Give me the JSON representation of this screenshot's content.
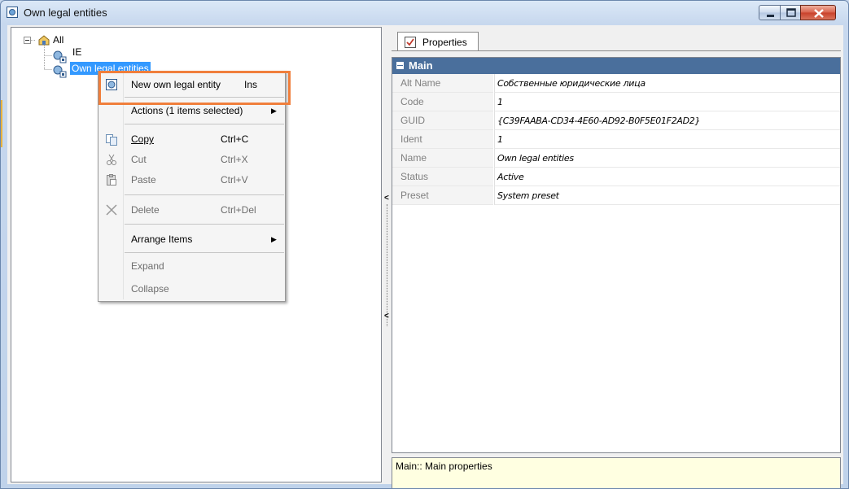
{
  "window": {
    "title": "Own legal entities",
    "controls": {
      "minimize": "minimize",
      "maximize": "maximize",
      "close": "close"
    }
  },
  "tree": {
    "root": {
      "label": "All",
      "icon": "folder-home-icon"
    },
    "children": [
      {
        "label": "IE",
        "icon": "legal-entity-icon"
      },
      {
        "label": "Own legal entities",
        "icon": "legal-entity-icon",
        "selected": true
      }
    ]
  },
  "context_menu": {
    "items": [
      {
        "label": "New own legal entity",
        "shortcut": "Ins",
        "icon": "new-entity-icon",
        "enabled": true
      },
      {
        "label": "Actions (1 items selected)",
        "submenu": true,
        "enabled": true
      },
      {
        "label": "Copy",
        "shortcut": "Ctrl+C",
        "icon": "copy-icon",
        "enabled": true
      },
      {
        "label": "Cut",
        "shortcut": "Ctrl+X",
        "icon": "cut-icon",
        "enabled": false
      },
      {
        "label": "Paste",
        "shortcut": "Ctrl+V",
        "icon": "paste-icon",
        "enabled": false
      },
      {
        "label": "Delete",
        "shortcut": "Ctrl+Del",
        "icon": "delete-icon",
        "enabled": false
      },
      {
        "label": "Arrange Items",
        "submenu": true,
        "enabled": true
      },
      {
        "label": "Expand",
        "enabled": false
      },
      {
        "label": "Collapse",
        "enabled": false
      }
    ]
  },
  "properties": {
    "tab_label": "Properties",
    "category": "Main",
    "rows": [
      {
        "name": "Alt Name",
        "value": "Собственные юридические лица"
      },
      {
        "name": "Code",
        "value": "1"
      },
      {
        "name": "GUID",
        "value": "{C39FAABA-CD34-4E60-AD92-B0F5E01F2AD2}"
      },
      {
        "name": "Ident",
        "value": "1"
      },
      {
        "name": "Name",
        "value": "Own legal entities"
      },
      {
        "name": "Status",
        "value": "Active"
      },
      {
        "name": "Preset",
        "value": "System preset"
      }
    ],
    "help_text": "Main:: Main properties"
  },
  "colors": {
    "accent_highlight": "#f07f3c",
    "selection": "#3399ff",
    "category_header": "#4a6f9c",
    "help_background": "#ffffe1"
  }
}
